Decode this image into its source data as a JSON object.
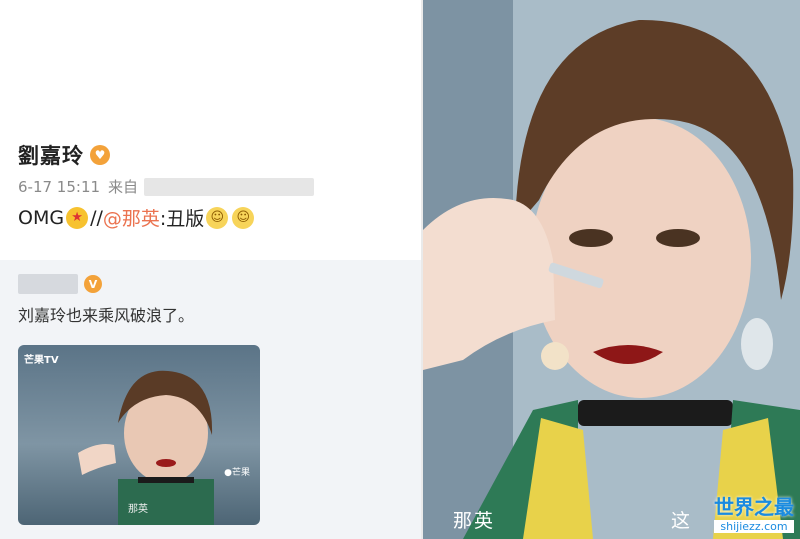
{
  "post": {
    "author": "劉嘉玲",
    "verified_icon": "red-heart-emoji",
    "timestamp": "6-17 15:11",
    "from_label": "来自",
    "text_prefix": "OMG",
    "text_sep": "//",
    "mention": "@那英",
    "text_suffix": ":丑版"
  },
  "repost": {
    "text": "刘嘉玲也来乘风破浪了。",
    "verified_badge": "V",
    "thumb_show": "芒果TV",
    "thumb_caption": "那英"
  },
  "video_panel": {
    "caption_name": "那英",
    "caption_next": "这"
  },
  "watermark": {
    "cn": "世界之最",
    "en": "shijiezz.com"
  },
  "colors": {
    "mention": "#eb7350",
    "verified": "#f3a23a",
    "watermark": "#1a8be0"
  }
}
